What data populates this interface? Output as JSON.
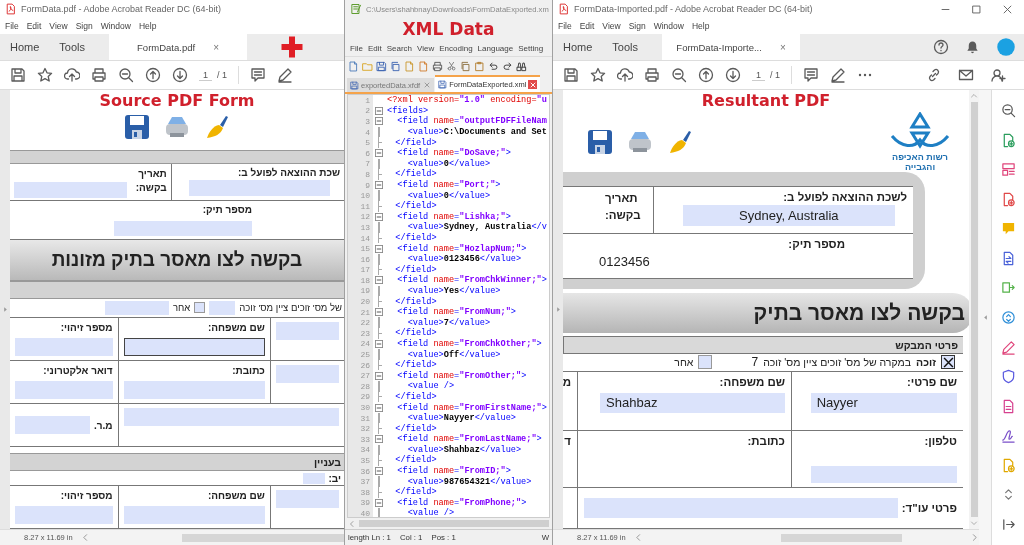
{
  "source": {
    "title": "FormData.pdf - Adobe Acrobat Reader DC (64-bit)",
    "menu": [
      "File",
      "Edit",
      "View",
      "Sign",
      "Window",
      "Help"
    ],
    "tabs": [
      {
        "label": "Home",
        "selected": false
      },
      {
        "label": "Tools",
        "selected": false
      },
      {
        "label": "FormData.pdf",
        "selected": true
      }
    ],
    "tab_close": "×",
    "page": "1",
    "pages": "/ 1",
    "caption": "Source PDF Form",
    "form": {
      "office_label": "שכת ההוצאה לפועל ב:",
      "date_label": "תאריך בקשה:",
      "case_label": "מספר תיק:",
      "banner": "בקשה לצו מאסר בתיק מזונות",
      "winner_text": "של מס' זוכים ציין מס' זוכה",
      "other": {
        "label": "אחר",
        "checked": false
      },
      "rows": [
        [
          {
            "kind": "stacked",
            "label": "מספר זיהוי:",
            "focused": false
          },
          {
            "kind": "stacked",
            "label": "שם משפחה:",
            "focused": true
          },
          {
            "kind": "field",
            "focused": false
          }
        ],
        [
          {
            "kind": "stacked",
            "label": "דואר אלקטרוני:",
            "focused": false
          },
          {
            "kind": "stacked",
            "label": "כתובת:",
            "focused": false
          },
          {
            "kind": "field",
            "focused": false
          }
        ],
        [
          {
            "kind": "inline",
            "label": "מ.ר.",
            "focused": false
          },
          {
            "kind": "field",
            "focused": false
          },
          ""
        ]
      ],
      "respondent": {
        "section": "בעניין",
        "section_label": "יב:",
        "rows": [
          [
            {
              "kind": "stacked",
              "label": "מספר זיהוי:",
              "focused": false
            },
            {
              "kind": "stacked",
              "label": "שם משפחה:",
              "focused": false
            },
            {
              "kind": "field",
              "focused": false
            }
          ]
        ]
      }
    },
    "page_size": "8.27 x 11.69 in"
  },
  "xml": {
    "title": "C:\\Users\\shahbnay\\Downloads\\FormDataExported.xm",
    "caption": "XML Data",
    "menu": [
      "File",
      "Edit",
      "Search",
      "View",
      "Encoding",
      "Language",
      "Setting"
    ],
    "tabs": [
      {
        "label": "exportedData.xfdf",
        "selected": false
      },
      {
        "label": "FormDataExported.xml",
        "selected": true
      }
    ],
    "lines": [
      {
        "n": "1",
        "kind": "plain",
        "parts": [
          {
            "kind": "pi",
            "text": "<?xml version="
          },
          {
            "kind": "str",
            "text": "\"1.0\""
          },
          {
            "kind": "pi",
            "text": " encoding="
          },
          {
            "kind": "str",
            "text": "\"u"
          }
        ]
      },
      {
        "n": "2",
        "kind": "open",
        "parts": [
          {
            "kind": "tag",
            "text": "<fields>"
          }
        ]
      },
      {
        "n": "3",
        "kind": "open",
        "parts": [
          {
            "kind": "tag",
            "text": "  <field "
          },
          {
            "kind": "attr",
            "text": "name"
          },
          {
            "kind": "tag",
            "text": "="
          },
          {
            "kind": "str",
            "text": "\"outputFDFFileNam"
          }
        ]
      },
      {
        "n": "4",
        "kind": "body",
        "parts": [
          {
            "kind": "tag",
            "text": "    <value>"
          },
          {
            "kind": "text",
            "text": "C:\\Documents and Set"
          }
        ]
      },
      {
        "n": "5",
        "kind": "end",
        "parts": [
          {
            "kind": "tag",
            "text": "  </field>"
          }
        ]
      },
      {
        "n": "6",
        "kind": "open",
        "parts": [
          {
            "kind": "tag",
            "text": "  <field "
          },
          {
            "kind": "attr",
            "text": "name"
          },
          {
            "kind": "tag",
            "text": "="
          },
          {
            "kind": "str",
            "text": "\"DoSave;\""
          },
          {
            "kind": "tag",
            "text": ">"
          }
        ]
      },
      {
        "n": "7",
        "kind": "body",
        "parts": [
          {
            "kind": "tag",
            "text": "    <value>"
          },
          {
            "kind": "text",
            "text": "0"
          },
          {
            "kind": "tag",
            "text": "</value>"
          }
        ]
      },
      {
        "n": "8",
        "kind": "end",
        "parts": [
          {
            "kind": "tag",
            "text": "  </field>"
          }
        ]
      },
      {
        "n": "9",
        "kind": "open",
        "parts": [
          {
            "kind": "tag",
            "text": "  <field "
          },
          {
            "kind": "attr",
            "text": "name"
          },
          {
            "kind": "tag",
            "text": "="
          },
          {
            "kind": "str",
            "text": "\"Port;\""
          },
          {
            "kind": "tag",
            "text": ">"
          }
        ]
      },
      {
        "n": "10",
        "kind": "body",
        "parts": [
          {
            "kind": "tag",
            "text": "    <value>"
          },
          {
            "kind": "text",
            "text": "0"
          },
          {
            "kind": "tag",
            "text": "</value>"
          }
        ]
      },
      {
        "n": "11",
        "kind": "end",
        "parts": [
          {
            "kind": "tag",
            "text": "  </field>"
          }
        ]
      },
      {
        "n": "12",
        "kind": "open",
        "parts": [
          {
            "kind": "tag",
            "text": "  <field "
          },
          {
            "kind": "attr",
            "text": "name"
          },
          {
            "kind": "tag",
            "text": "="
          },
          {
            "kind": "str",
            "text": "\"Lishka;\""
          },
          {
            "kind": "tag",
            "text": ">"
          }
        ]
      },
      {
        "n": "13",
        "kind": "body",
        "parts": [
          {
            "kind": "tag",
            "text": "    <value>"
          },
          {
            "kind": "text",
            "text": "Sydney, Australia"
          },
          {
            "kind": "tag",
            "text": "</v"
          }
        ]
      },
      {
        "n": "14",
        "kind": "end",
        "parts": [
          {
            "kind": "tag",
            "text": "  </field>"
          }
        ]
      },
      {
        "n": "15",
        "kind": "open",
        "parts": [
          {
            "kind": "tag",
            "text": "  <field "
          },
          {
            "kind": "attr",
            "text": "name"
          },
          {
            "kind": "tag",
            "text": "="
          },
          {
            "kind": "str",
            "text": "\"HozlapNum;\""
          },
          {
            "kind": "tag",
            "text": ">"
          }
        ]
      },
      {
        "n": "16",
        "kind": "body",
        "parts": [
          {
            "kind": "tag",
            "text": "    <value>"
          },
          {
            "kind": "text",
            "text": "0123456"
          },
          {
            "kind": "tag",
            "text": "</value>"
          }
        ]
      },
      {
        "n": "17",
        "kind": "end",
        "parts": [
          {
            "kind": "tag",
            "text": "  </field>"
          }
        ]
      },
      {
        "n": "18",
        "kind": "open",
        "parts": [
          {
            "kind": "tag",
            "text": "  <field "
          },
          {
            "kind": "attr",
            "text": "name"
          },
          {
            "kind": "tag",
            "text": "="
          },
          {
            "kind": "str",
            "text": "\"FromChkWinner;\""
          },
          {
            "kind": "tag",
            "text": ">"
          }
        ]
      },
      {
        "n": "19",
        "kind": "body",
        "parts": [
          {
            "kind": "tag",
            "text": "    <value>"
          },
          {
            "kind": "text",
            "text": "Yes"
          },
          {
            "kind": "tag",
            "text": "</value>"
          }
        ]
      },
      {
        "n": "20",
        "kind": "end",
        "parts": [
          {
            "kind": "tag",
            "text": "  </field>"
          }
        ]
      },
      {
        "n": "21",
        "kind": "open",
        "parts": [
          {
            "kind": "tag",
            "text": "  <field "
          },
          {
            "kind": "attr",
            "text": "name"
          },
          {
            "kind": "tag",
            "text": "="
          },
          {
            "kind": "str",
            "text": "\"FromNum;\""
          },
          {
            "kind": "tag",
            "text": ">"
          }
        ]
      },
      {
        "n": "22",
        "kind": "body",
        "parts": [
          {
            "kind": "tag",
            "text": "    <value>"
          },
          {
            "kind": "text",
            "text": "7"
          },
          {
            "kind": "tag",
            "text": "</value>"
          }
        ]
      },
      {
        "n": "23",
        "kind": "end",
        "parts": [
          {
            "kind": "tag",
            "text": "  </field>"
          }
        ]
      },
      {
        "n": "24",
        "kind": "open",
        "parts": [
          {
            "kind": "tag",
            "text": "  <field "
          },
          {
            "kind": "attr",
            "text": "name"
          },
          {
            "kind": "tag",
            "text": "="
          },
          {
            "kind": "str",
            "text": "\"FromChkOther;\""
          },
          {
            "kind": "tag",
            "text": ">"
          }
        ]
      },
      {
        "n": "25",
        "kind": "body",
        "parts": [
          {
            "kind": "tag",
            "text": "    <value>"
          },
          {
            "kind": "text",
            "text": "Off"
          },
          {
            "kind": "tag",
            "text": "</value>"
          }
        ]
      },
      {
        "n": "26",
        "kind": "end",
        "parts": [
          {
            "kind": "tag",
            "text": "  </field>"
          }
        ]
      },
      {
        "n": "27",
        "kind": "open",
        "parts": [
          {
            "kind": "tag",
            "text": "  <field "
          },
          {
            "kind": "attr",
            "text": "name"
          },
          {
            "kind": "tag",
            "text": "="
          },
          {
            "kind": "str",
            "text": "\"FromOther;\""
          },
          {
            "kind": "tag",
            "text": ">"
          }
        ]
      },
      {
        "n": "28",
        "kind": "body",
        "parts": [
          {
            "kind": "tag",
            "text": "    <value />"
          }
        ]
      },
      {
        "n": "29",
        "kind": "end",
        "parts": [
          {
            "kind": "tag",
            "text": "  </field>"
          }
        ]
      },
      {
        "n": "30",
        "kind": "open",
        "parts": [
          {
            "kind": "tag",
            "text": "  <field "
          },
          {
            "kind": "attr",
            "text": "name"
          },
          {
            "kind": "tag",
            "text": "="
          },
          {
            "kind": "str",
            "text": "\"FromFirstName;\""
          },
          {
            "kind": "tag",
            "text": ">"
          }
        ]
      },
      {
        "n": "31",
        "kind": "body",
        "parts": [
          {
            "kind": "tag",
            "text": "    <value>"
          },
          {
            "kind": "text",
            "text": "Nayyer"
          },
          {
            "kind": "tag",
            "text": "</value>"
          }
        ]
      },
      {
        "n": "32",
        "kind": "end",
        "parts": [
          {
            "kind": "tag",
            "text": "  </field>"
          }
        ]
      },
      {
        "n": "33",
        "kind": "open",
        "parts": [
          {
            "kind": "tag",
            "text": "  <field "
          },
          {
            "kind": "attr",
            "text": "name"
          },
          {
            "kind": "tag",
            "text": "="
          },
          {
            "kind": "str",
            "text": "\"FromLastName;\""
          },
          {
            "kind": "tag",
            "text": ">"
          }
        ]
      },
      {
        "n": "34",
        "kind": "body",
        "parts": [
          {
            "kind": "tag",
            "text": "    <value>"
          },
          {
            "kind": "text",
            "text": "Shahbaz"
          },
          {
            "kind": "tag",
            "text": "</value>"
          }
        ]
      },
      {
        "n": "35",
        "kind": "end",
        "parts": [
          {
            "kind": "tag",
            "text": "  </field>"
          }
        ]
      },
      {
        "n": "36",
        "kind": "open",
        "parts": [
          {
            "kind": "tag",
            "text": "  <field "
          },
          {
            "kind": "attr",
            "text": "name"
          },
          {
            "kind": "tag",
            "text": "="
          },
          {
            "kind": "str",
            "text": "\"FromID;\""
          },
          {
            "kind": "tag",
            "text": ">"
          }
        ]
      },
      {
        "n": "37",
        "kind": "body",
        "parts": [
          {
            "kind": "tag",
            "text": "    <value>"
          },
          {
            "kind": "text",
            "text": "987654321"
          },
          {
            "kind": "tag",
            "text": "</value>"
          }
        ]
      },
      {
        "n": "38",
        "kind": "end",
        "parts": [
          {
            "kind": "tag",
            "text": "  </field>"
          }
        ]
      },
      {
        "n": "39",
        "kind": "open",
        "parts": [
          {
            "kind": "tag",
            "text": "  <field "
          },
          {
            "kind": "attr",
            "text": "name"
          },
          {
            "kind": "tag",
            "text": "="
          },
          {
            "kind": "str",
            "text": "\"FromPhone;\""
          },
          {
            "kind": "tag",
            "text": ">"
          }
        ]
      },
      {
        "n": "40",
        "kind": "body",
        "parts": [
          {
            "kind": "tag",
            "text": "    <value />"
          }
        ]
      }
    ],
    "status": [
      "length Ln : 1",
      "Col : 1",
      "Pos : 1"
    ],
    "status_right": "W"
  },
  "result": {
    "title": "FormData-Imported.pdf - Adobe Acrobat Reader DC (64-bit)",
    "menu": [
      "File",
      "Edit",
      "View",
      "Sign",
      "Window",
      "Help"
    ],
    "tabs": [
      {
        "label": "Home",
        "selected": false
      },
      {
        "label": "Tools",
        "selected": false
      },
      {
        "label": "FormData-Importe...",
        "selected": true
      }
    ],
    "tab_close": "×",
    "page": "1",
    "pages": "/ 1",
    "caption": "Resultant PDF",
    "logo_text": [
      "רשות האכיפה",
      "והגבייה"
    ],
    "form": {
      "office_label": "לשכת ההוצאה לפועל ב:",
      "office_value": "Sydney, Australia",
      "date_label": "תאריך בקשה:",
      "case_label": "מספר תיק:",
      "case_value": "0123456",
      "banner": "בקשה לצו מאסר בתיק",
      "section": "פרטי המבקש",
      "winner": {
        "label": "זוכה",
        "checked": true
      },
      "winner_text": "במקרה של מס' זוכים ציין מס' זוכה",
      "winner_number": "7",
      "other": {
        "label": "אחר",
        "checked": false
      },
      "rows": [
        [
          {
            "kind": "label",
            "label": "מ"
          },
          {
            "kind": "stacked",
            "label": "שם משפחה:",
            "value": "Shahbaz"
          },
          {
            "kind": "stacked",
            "label": "שם פרטי:",
            "value": "Nayyer"
          }
        ],
        [
          {
            "kind": "label",
            "label": "ד"
          },
          {
            "kind": "label",
            "label": "כתובת:"
          },
          {
            "kind": "stacked",
            "label": "טלפון:"
          }
        ],
        [
          {
            "kind": "blank"
          },
          "",
          {
            "kind": "inline",
            "label": "פרטי עו\"ד:"
          }
        ]
      ]
    },
    "page_size": "8.27 x 11.69 in"
  }
}
